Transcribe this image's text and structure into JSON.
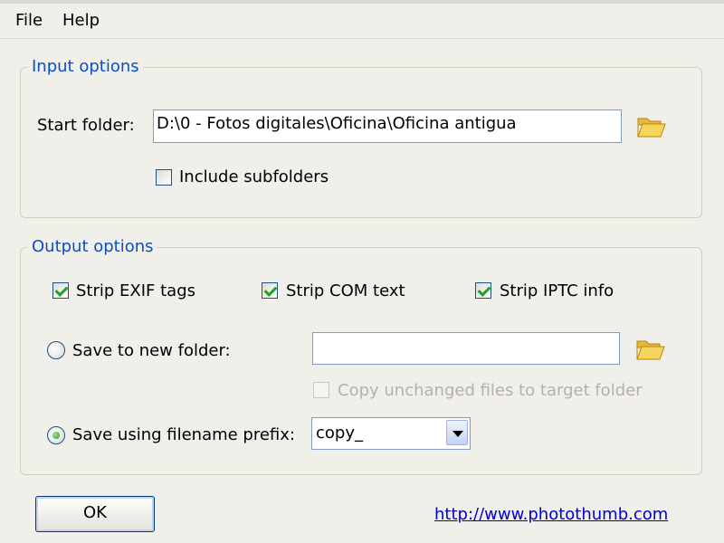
{
  "menu": {
    "file": "File",
    "help": "Help"
  },
  "input_options": {
    "title": "Input options",
    "start_folder_label": "Start folder:",
    "start_folder_value": "D:\\0 - Fotos digitales\\Oficina\\Oficina antigua",
    "include_subfolders_label": "Include subfolders",
    "include_subfolders_checked": false
  },
  "output_options": {
    "title": "Output options",
    "strip_exif_label": "Strip EXIF tags",
    "strip_com_label": "Strip COM text",
    "strip_iptc_label": "Strip IPTC info",
    "save_new_folder_label": "Save to new folder:",
    "new_folder_value": "",
    "copy_unchanged_label": "Copy unchanged files to target folder",
    "save_prefix_label": "Save using filename prefix:",
    "prefix_value": "copy_"
  },
  "footer": {
    "ok_label": "OK",
    "link_text": "http://www.photothumb.com"
  },
  "icons": {
    "folder": "folder-open-icon",
    "dropdown": "chevron-down-icon"
  },
  "colors": {
    "group_title": "#0a4fc7",
    "link": "#0000cc",
    "check": "#21a121"
  }
}
